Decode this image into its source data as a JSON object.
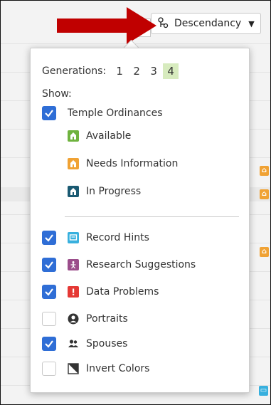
{
  "toolbar": {
    "view_label": "Descendancy",
    "caret": "▼"
  },
  "menu": {
    "generations_label": "Generations:",
    "generations": [
      "1",
      "2",
      "3",
      "4"
    ],
    "selected_generation": "4",
    "show_label": "Show:",
    "temple_ordinances": {
      "label": "Temple Ordinances",
      "checked": true
    },
    "ordinance_status": [
      {
        "label": "Available",
        "color": "#6fb33f",
        "icon": "temple-icon"
      },
      {
        "label": "Needs Information",
        "color": "#f0a234",
        "icon": "temple-icon"
      },
      {
        "label": "In Progress",
        "color": "#1a5a72",
        "icon": "temple-icon"
      }
    ],
    "options": [
      {
        "label": "Record Hints",
        "checked": true,
        "icon": "record-hint-icon",
        "color": "#38b0de"
      },
      {
        "label": "Research Suggestions",
        "checked": true,
        "icon": "research-suggestion-icon",
        "color": "#9b4d8b"
      },
      {
        "label": "Data Problems",
        "checked": true,
        "icon": "data-problem-icon",
        "color": "#e53935"
      },
      {
        "label": "Portraits",
        "checked": false,
        "icon": "portrait-icon",
        "color": "#333333"
      },
      {
        "label": "Spouses",
        "checked": true,
        "icon": "spouses-icon",
        "color": "#333333"
      },
      {
        "label": "Invert Colors",
        "checked": false,
        "icon": "invert-colors-icon",
        "color": "#333333"
      }
    ]
  },
  "accent_color": "#2f6ed6"
}
